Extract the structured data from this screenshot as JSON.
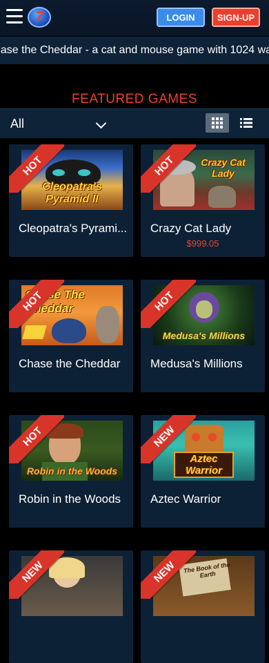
{
  "header": {
    "logo_text": "7",
    "login_label": "LOGIN",
    "signup_label": "SIGN-UP"
  },
  "ticker": {
    "text": "hase the Cheddar - a cat and mouse game with 1024 ways"
  },
  "section": {
    "title": "FEATURED GAMES"
  },
  "filter": {
    "selected": "All"
  },
  "games": [
    {
      "title": "Cleopatra's Pyrami...",
      "badge": "HOT",
      "art_text": "Cleopatra's Pyramid II",
      "price": ""
    },
    {
      "title": "Crazy Cat Lady",
      "badge": "HOT",
      "art_text": "Crazy Cat Lady",
      "price": "$999.05"
    },
    {
      "title": "Chase the Cheddar",
      "badge": "HOT",
      "art_text": "Chase The Cheddar",
      "price": ""
    },
    {
      "title": "Medusa's Millions",
      "badge": "HOT",
      "art_text": "Medusa's Millions",
      "price": ""
    },
    {
      "title": "Robin in the Woods",
      "badge": "HOT",
      "art_text": "Robin in the Woods",
      "price": ""
    },
    {
      "title": "Aztec Warrior",
      "badge": "NEW",
      "art_text": "Aztec Warrior",
      "price": ""
    },
    {
      "title": "",
      "badge": "NEW",
      "art_text": "",
      "price": ""
    },
    {
      "title": "",
      "badge": "NEW",
      "art_text": "The Book of the Earth",
      "price": ""
    }
  ]
}
